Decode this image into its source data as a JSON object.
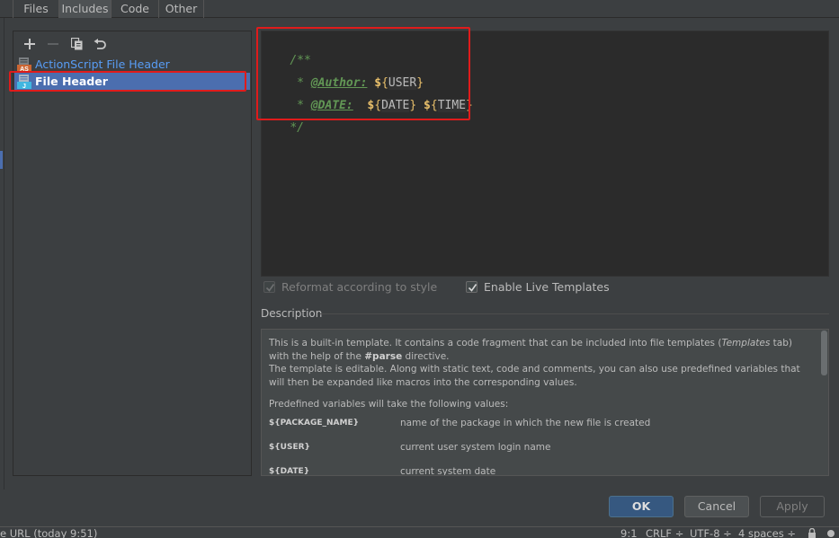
{
  "tabs": [
    {
      "label": "Files",
      "active": false
    },
    {
      "label": "Includes",
      "active": true
    },
    {
      "label": "Code",
      "active": false
    },
    {
      "label": "Other",
      "active": false
    }
  ],
  "toolbar": {
    "add_icon": "plus-icon",
    "remove_icon": "minus-icon",
    "copy_icon": "copy-icon",
    "reset_icon": "undo-icon"
  },
  "templates": [
    {
      "label": "ActionScript File Header",
      "selected": false,
      "icon": "actionscript-file-icon"
    },
    {
      "label": "File Header",
      "selected": true,
      "icon": "java-file-icon"
    }
  ],
  "editor": {
    "line1": "/**",
    "line2_prefix": " * ",
    "line2_tag": "@Author:",
    "line2_space": " ",
    "line2_var": "USER",
    "line3_prefix": " * ",
    "line3_tag": "@DATE:",
    "line3_space": "  ",
    "line3_var1": "DATE",
    "line3_var2": "TIME",
    "line4": "*/",
    "dollar": "$",
    "brace_open": "{",
    "brace_close": "}"
  },
  "options": {
    "reformat_label": "Reformat according to style",
    "reformat_checked": true,
    "reformat_enabled": false,
    "live_templates_label": "Enable Live Templates",
    "live_templates_checked": true
  },
  "description": {
    "title": "Description",
    "p1_a": "This is a built-in template. It contains a code fragment that can be included into file templates (",
    "p1_italic": "Templates",
    "p1_b": " tab) with the help of the ",
    "p1_bold": "#parse",
    "p1_c": " directive.",
    "p2": "The template is editable. Along with static text, code and comments, you can also use predefined variables that will then be expanded like macros into the corresponding values.",
    "p3": "Predefined variables will take the following values:",
    "variables": [
      {
        "name": "${PACKAGE_NAME}",
        "desc": "name of the package in which the new file is created"
      },
      {
        "name": "${USER}",
        "desc": "current user system login name"
      },
      {
        "name": "${DATE}",
        "desc": "current system date"
      }
    ]
  },
  "buttons": {
    "ok": "OK",
    "cancel": "Cancel",
    "apply": "Apply"
  },
  "status": {
    "left": "e URL (today 9:51)",
    "position": "9:1",
    "line_ending": "CRLF ÷",
    "encoding": "UTF-8 ÷",
    "indent": "4 spaces ÷"
  },
  "colors": {
    "highlight_red": "#e01b1b",
    "selection_blue": "#4b6eaf",
    "link_blue": "#589df6",
    "comment_green": "#629755",
    "variable_yellow": "#e8bf6a",
    "ok_button": "#365880"
  }
}
